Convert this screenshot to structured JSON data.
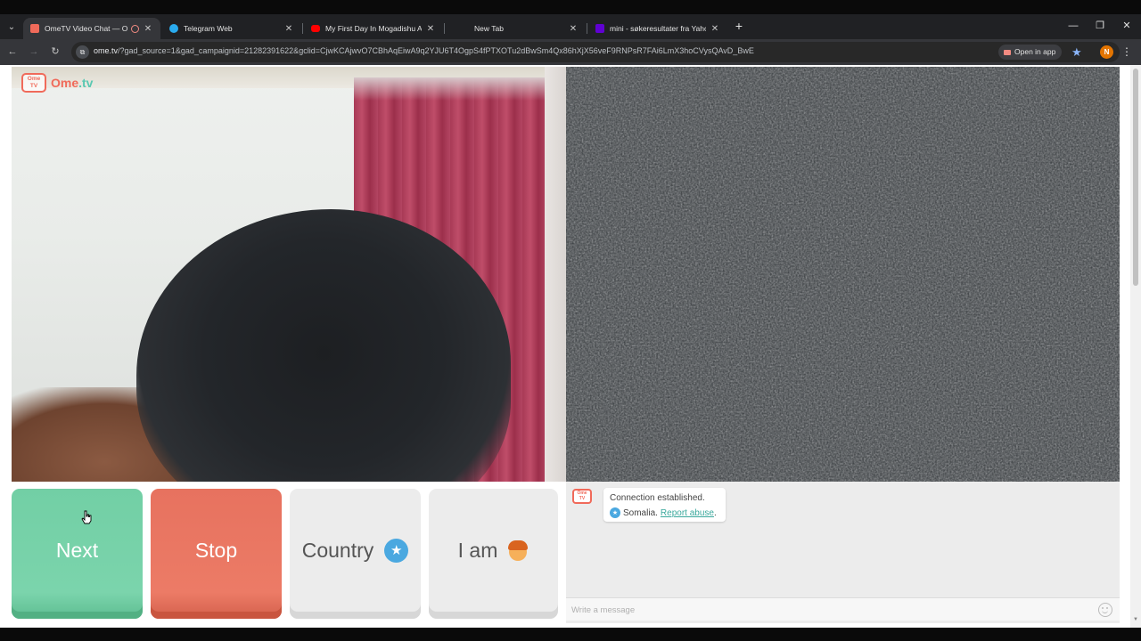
{
  "browser": {
    "tabs": [
      {
        "title": "OmeTV Video Chat — Ome",
        "favicon": "ometv-icon",
        "active": true
      },
      {
        "title": "Telegram Web",
        "favicon": "telegram-icon",
        "active": false
      },
      {
        "title": "My First Day In Mogadishu An",
        "favicon": "youtube-icon",
        "active": false
      },
      {
        "title": "New Tab",
        "favicon": "",
        "active": false
      },
      {
        "title": "mini - søkeresultater fra Yahoo",
        "favicon": "yahoo-icon",
        "active": false
      }
    ],
    "url_host": "ome.tv",
    "url_rest": "/?gad_source=1&gad_campaignid=21282391622&gclid=CjwKCAjwvO7CBhAqEiwA9q2YJU6T4OgpS4fPTXOTu2dBwSm4Qx86hXjX56veF9RNPsR7FAi6LmX3hoCVysQAvD_BwE",
    "open_in_app": "Open in app",
    "profile_initial": "N"
  },
  "site": {
    "logo_badge": "Ome TV",
    "logo_name": "Ome",
    "logo_tld": ".tv"
  },
  "controls": {
    "next": "Next",
    "stop": "Stop",
    "country": "Country",
    "iam": "I am"
  },
  "chat": {
    "message_line1": "Connection established.",
    "country": "Somalia.",
    "report": "Report abuse",
    "report_suffix": ".",
    "placeholder": "Write a message"
  },
  "colors": {
    "next": "#72cfa5",
    "stop": "#e7725f",
    "brand": "#f06a5a",
    "accent_teal": "#5ac8b2",
    "country_star": "#4aa8e0"
  }
}
